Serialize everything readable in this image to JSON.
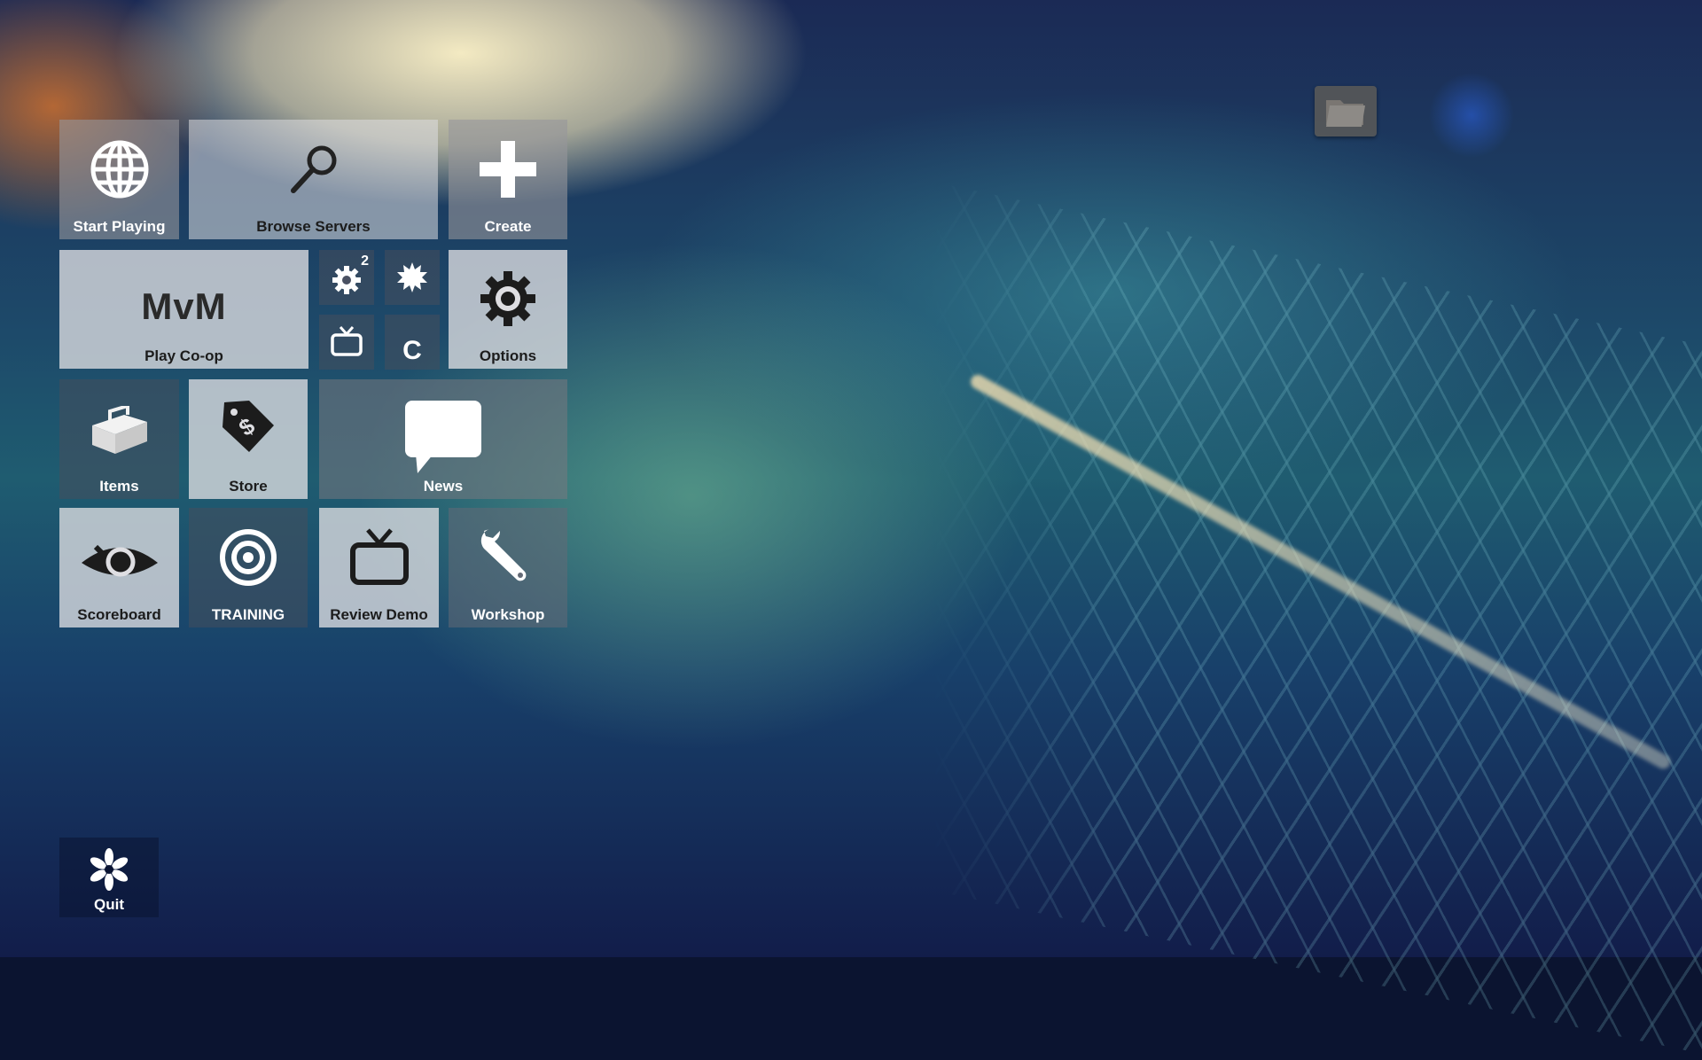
{
  "tiles": {
    "start_playing": {
      "label": "Start Playing",
      "icon": "globe-icon"
    },
    "browse_servers": {
      "label": "Browse Servers",
      "icon": "magnifier-icon"
    },
    "create": {
      "label": "Create",
      "icon": "plus-icon"
    },
    "play_coop": {
      "label": "Play Co-op",
      "title": "MvM"
    },
    "small_gear": {
      "badge": "2",
      "icon": "gear-icon"
    },
    "small_burst": {
      "icon": "burst-icon"
    },
    "small_tv": {
      "icon": "tv-icon"
    },
    "small_c": {
      "text": "C"
    },
    "options": {
      "label": "Options",
      "icon": "gear-icon"
    },
    "items": {
      "label": "Items",
      "icon": "toolbox-icon"
    },
    "store": {
      "label": "Store",
      "icon": "price-tag-icon"
    },
    "news": {
      "label": "News",
      "icon": "speech-bubble-icon"
    },
    "scoreboard": {
      "label": "Scoreboard",
      "icon": "eye-icon"
    },
    "training": {
      "label": "TRAINING",
      "icon": "target-icon"
    },
    "review_demo": {
      "label": "Review Demo",
      "icon": "tv-icon"
    },
    "workshop": {
      "label": "Workshop",
      "icon": "wrench-icon"
    },
    "quit": {
      "label": "Quit",
      "icon": "quit-flower-icon"
    }
  },
  "folder_button": {
    "icon": "folder-icon"
  }
}
